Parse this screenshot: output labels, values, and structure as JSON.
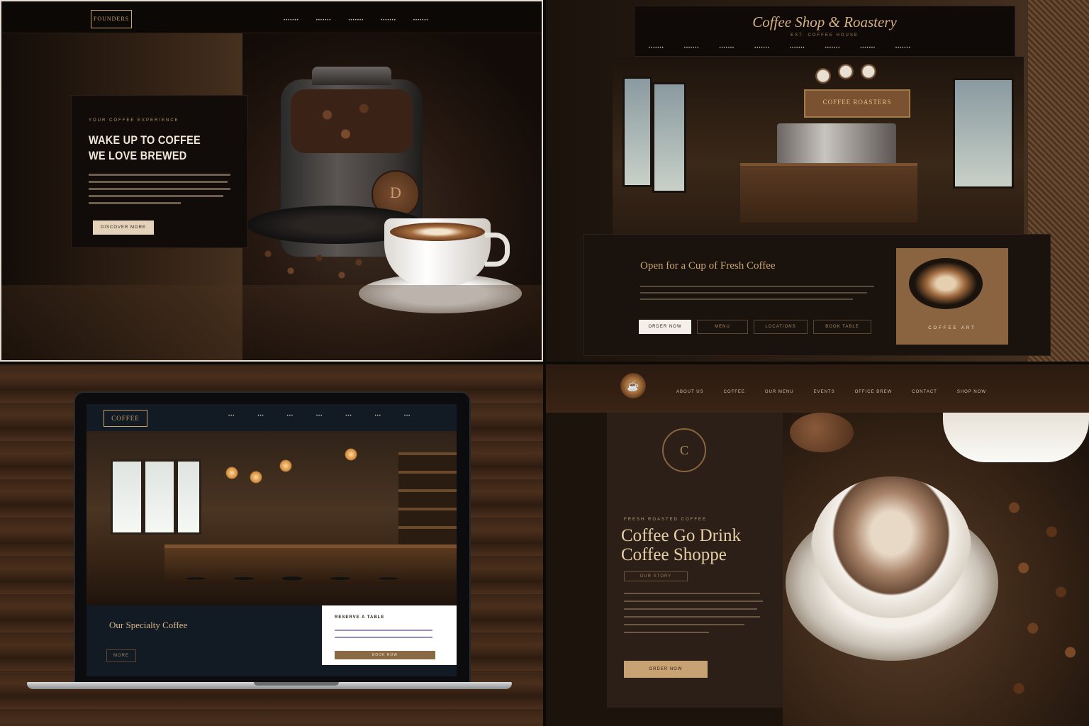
{
  "quad1": {
    "logo": "FOUNDERS",
    "nav": [
      "•••••••",
      "•••••••",
      "•••••••",
      "•••••••",
      "•••••••"
    ],
    "eyebrow": "YOUR COFFEE EXPERIENCE",
    "headline": "WAKE UP TO COFFEE WE LOVE BREWED",
    "body_line_count": 5,
    "button": "DISCOVER MORE",
    "seal_glyph": "D"
  },
  "quad2": {
    "title": "Coffee Shop & Roastery",
    "subtitle": "EST. COFFEE HOUSE",
    "nav": [
      "•••••••",
      "•••••••",
      "•••••••",
      "•••••••",
      "•••••••",
      "•••••••",
      "•••••••",
      "•••••••"
    ],
    "sign": "COFFEE ROASTERS",
    "panel_title": "Open for a Cup of Fresh Coffee",
    "buttons": [
      "ORDER NOW",
      "MENU",
      "LOCATIONS",
      "BOOK TABLE"
    ],
    "thumb_caption": "COFFEE ART"
  },
  "quad3": {
    "logo": "COFFEE",
    "nav": [
      "•••",
      "•••",
      "•••",
      "•••",
      "•••",
      "•••",
      "•••"
    ],
    "title": "Our Specialty Coffee",
    "button": "MORE",
    "card_title": "RESERVE A TABLE",
    "card_button": "BOOK NOW"
  },
  "quad4": {
    "nav": [
      "ABOUT US",
      "COFFEE",
      "OUR MENU",
      "EVENTS",
      "OFFICE BREW",
      "CONTACT",
      "SHOP NOW"
    ],
    "emblem": "C",
    "eyebrow": "FRESH ROASTED COFFEE",
    "headline": "Coffee Go Drink Coffee Shoppe",
    "tag": "OUR STORY",
    "button": "ORDER NOW",
    "logo_glyph": "☕"
  }
}
